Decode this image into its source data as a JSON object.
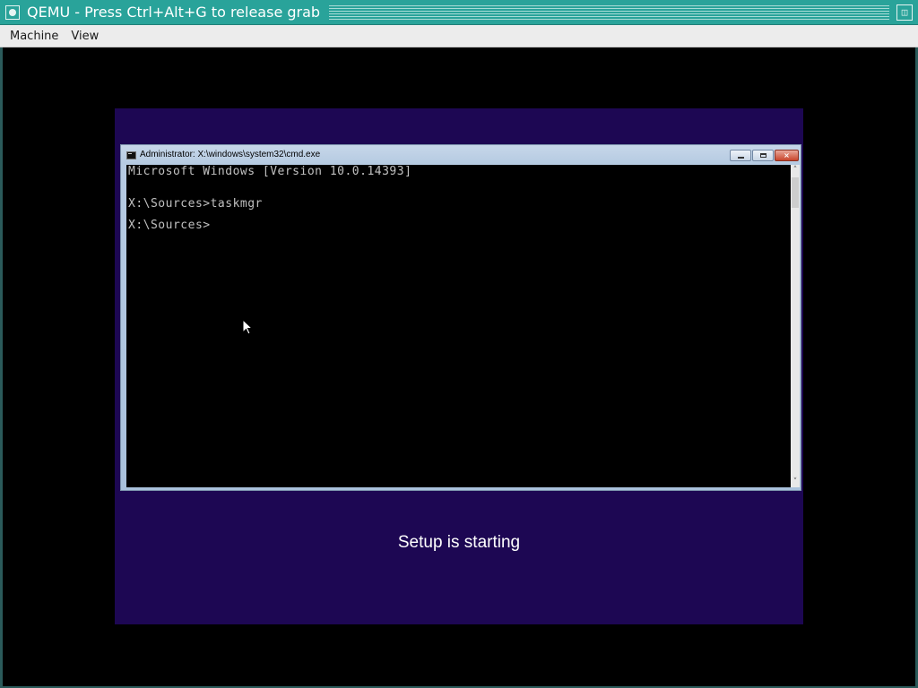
{
  "host": {
    "title": "QEMU - Press Ctrl+Alt+G to release grab",
    "app_icon": "qemu-icon",
    "title_button_icon": "window-menu-icon",
    "menu": [
      {
        "label": "Machine"
      },
      {
        "label": "View"
      }
    ]
  },
  "guest": {
    "cmd_window": {
      "title": "Administrator: X:\\windows\\system32\\cmd.exe",
      "icon": "cmd-icon",
      "controls": [
        "minimize-icon",
        "restore-icon",
        "close-icon"
      ],
      "close_glyph": "×",
      "console_lines": [
        "Microsoft Windows [Version 10.0.14393]",
        "",
        "X:\\Sources>taskmgr",
        "",
        "X:\\Sources>"
      ]
    },
    "setup_status": "Setup is starting"
  },
  "colors": {
    "host_titlebar": "#29a39a",
    "setup_background": "#1d0753",
    "console_text": "#c0c0c0",
    "console_background": "#000000"
  }
}
